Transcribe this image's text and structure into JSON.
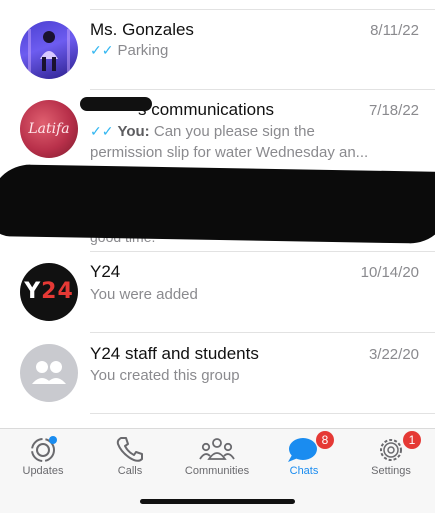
{
  "chats": [
    {
      "name": "Ms. Gonzales",
      "date": "8/11/22",
      "preview": "Parking"
    },
    {
      "name": "s communications",
      "date": "7/18/22",
      "preview_sender": "You:",
      "preview": "Can you please sign the permission slip for water Wednesday an..."
    },
    {
      "preview": "good time."
    },
    {
      "name": "Y24",
      "date": "10/14/20",
      "preview": "You were added"
    },
    {
      "name": "Y24 staff and students",
      "date": "3/22/20",
      "preview": "You created this group"
    }
  ],
  "avatars": {
    "latifa_text": "Latifa",
    "y24_text_white": "Y",
    "y24_text_red": "24"
  },
  "tabbar": {
    "tabs": [
      {
        "label": "Updates"
      },
      {
        "label": "Calls"
      },
      {
        "label": "Communities"
      },
      {
        "label": "Chats",
        "badge": "8"
      },
      {
        "label": "Settings",
        "badge": "1"
      }
    ],
    "active_tab": "Chats"
  },
  "colors": {
    "accent": "#1a8cf0",
    "read_ticks": "#34b7f1",
    "badge": "#e53935"
  },
  "icons": [
    "updates-icon",
    "calls-icon",
    "communities-icon",
    "chats-icon",
    "settings-icon",
    "double-check-icon",
    "group-icon"
  ]
}
